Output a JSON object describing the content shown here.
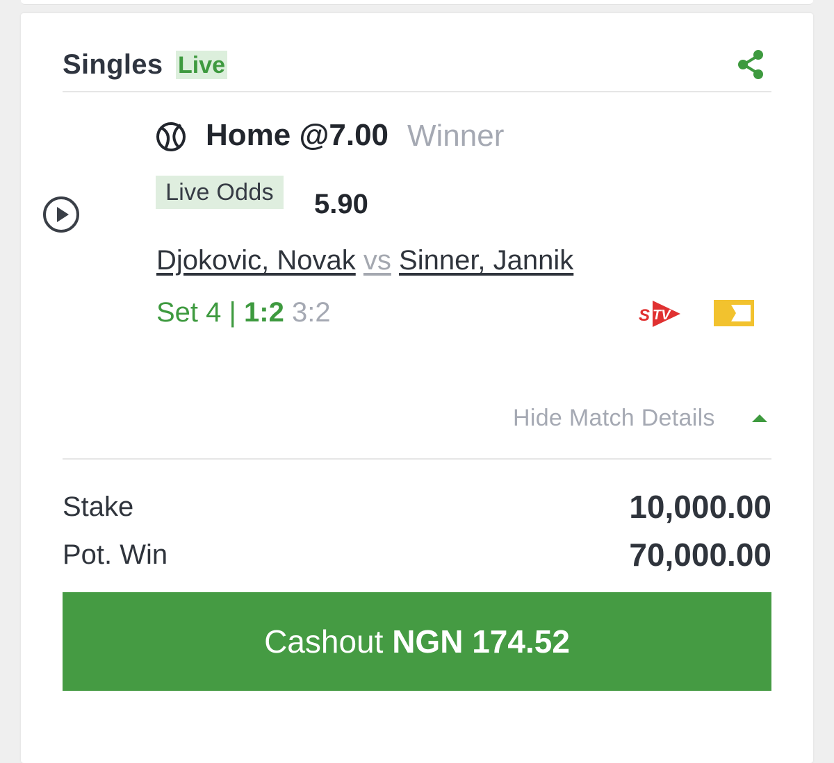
{
  "header": {
    "title": "Singles",
    "live_badge": "Live"
  },
  "bet": {
    "selection": "Home @7.00",
    "market": "Winner",
    "live_odds_label": "Live Odds",
    "live_odds_value": "5.90",
    "team_home": "Djokovic, Novak",
    "vs": "vs",
    "team_away": "Sinner, Jannik",
    "score": {
      "set_label": "Set 4 | ",
      "set_score": "1:2",
      "game_score": "3:2"
    },
    "hide_details": "Hide Match Details"
  },
  "stake": {
    "label": "Stake",
    "value": "10,000.00"
  },
  "pot_win": {
    "label": "Pot. Win",
    "value": "70,000.00"
  },
  "cashout": {
    "label": "Cashout",
    "amount": "NGN 174.52"
  },
  "icons": [
    "share-icon",
    "play-icon",
    "tennis-ball-icon",
    "stv-icon",
    "ticket-icon",
    "chevron-up-icon"
  ],
  "colors": {
    "accent_green": "#459b43",
    "live_green": "#3e9a3f",
    "badge_bg": "#dcefdc",
    "muted_text": "#a5a9b3",
    "stv_red": "#e03131",
    "ticket_yellow": "#f2c22e"
  }
}
